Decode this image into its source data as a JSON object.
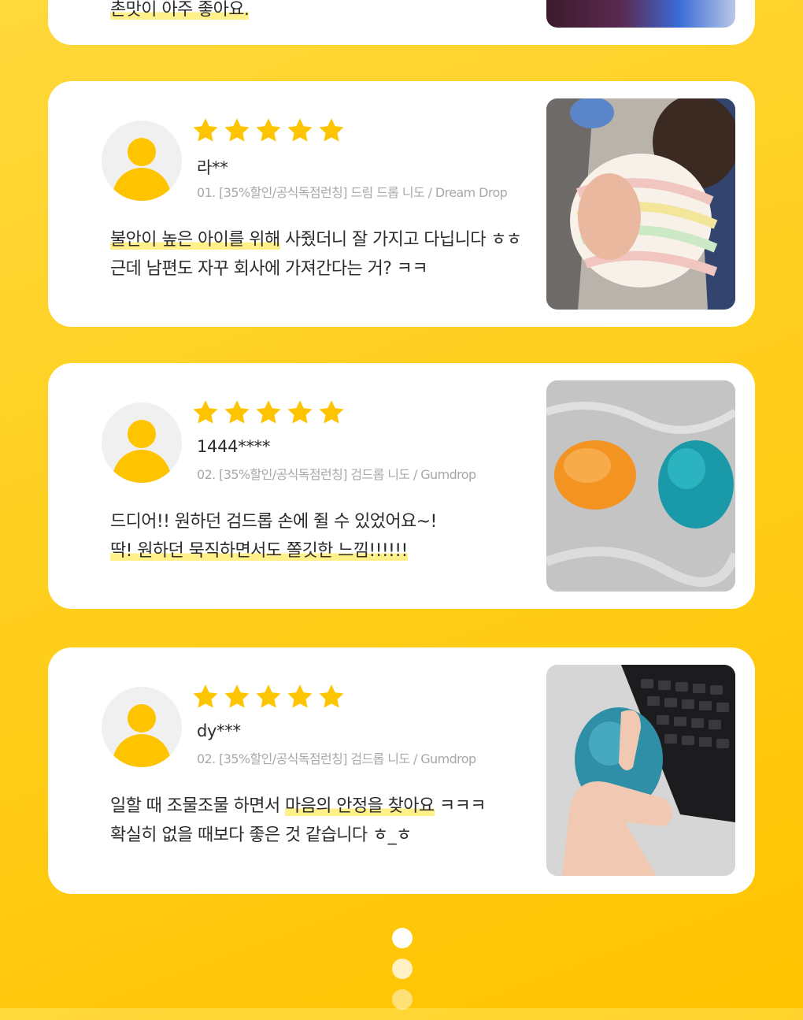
{
  "reviews": [
    {
      "partial": true,
      "text_lines": [
        {
          "plain": "",
          "highlight": "촌맛이 아주 좋아요.",
          "tail": ""
        }
      ]
    },
    {
      "username": "라**",
      "product": "01. [35%할인/공식독점런칭] 드림 드롭 니도 / Dream Drop",
      "rating": 5,
      "text_lines": [
        {
          "plain": "",
          "highlight": "불안이 높은 아이를 위해",
          "tail": " 사줬더니 잘 가지고 다닙니다 ㅎㅎ"
        },
        {
          "plain": "근데 남편도 자꾸 회사에 가져간다는 거? ㅋㅋ",
          "highlight": "",
          "tail": ""
        }
      ],
      "photo_icon": "child-holding-ball-photo"
    },
    {
      "username": "1444****",
      "product": "02. [35%할인/공식독점런칭] 검드롭 니도 / Gumdrop",
      "rating": 5,
      "text_lines": [
        {
          "plain": "드디어!! 원하던 검드롭 손에 쥘 수 있었어요~!",
          "highlight": "",
          "tail": ""
        },
        {
          "plain": "",
          "highlight": "딱! 원하던 묵직하면서도 쫄깃한 느낌!!!!!!",
          "tail": ""
        }
      ],
      "photo_icon": "gumdrop-balls-photo"
    },
    {
      "username": "dy***",
      "product": "02. [35%할인/공식독점런칭] 검드롭 니도 / Gumdrop",
      "rating": 5,
      "text_lines": [
        {
          "plain": "일할 때 조물조물 하면서 ",
          "highlight": "마음의 안정을 찾아요",
          "tail": " ㅋㅋㅋ"
        },
        {
          "plain": "확실히 없을 때보다 좋은 것 같습니다 ㅎ_ㅎ",
          "highlight": "",
          "tail": ""
        }
      ],
      "photo_icon": "hand-squeezing-ball-photo"
    }
  ],
  "colors": {
    "accent": "#ffc400",
    "star": "#ffc400",
    "highlight": "#fff08a"
  },
  "pagination_dots": 3
}
